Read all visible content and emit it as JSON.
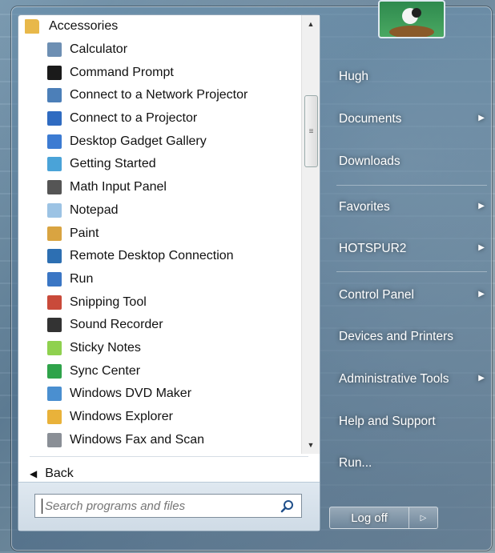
{
  "programs": {
    "folder": {
      "label": "Accessories",
      "icon": "folder-icon",
      "color": "#e8b84a"
    },
    "items": [
      {
        "label": "Calculator",
        "icon": "calculator-icon",
        "color": "#6d8fb3"
      },
      {
        "label": "Command Prompt",
        "icon": "command-prompt-icon",
        "color": "#1a1a1a"
      },
      {
        "label": "Connect to a Network Projector",
        "icon": "network-projector-icon",
        "color": "#4c7fb8"
      },
      {
        "label": "Connect to a Projector",
        "icon": "projector-icon",
        "color": "#2f6bc1"
      },
      {
        "label": "Desktop Gadget Gallery",
        "icon": "gadget-gallery-icon",
        "color": "#3c7bd2"
      },
      {
        "label": "Getting Started",
        "icon": "getting-started-icon",
        "color": "#4aa3d8"
      },
      {
        "label": "Math Input Panel",
        "icon": "math-input-icon",
        "color": "#555555"
      },
      {
        "label": "Notepad",
        "icon": "notepad-icon",
        "color": "#9cc3e4"
      },
      {
        "label": "Paint",
        "icon": "paint-icon",
        "color": "#d9a441"
      },
      {
        "label": "Remote Desktop Connection",
        "icon": "remote-desktop-icon",
        "color": "#2d6fb2"
      },
      {
        "label": "Run",
        "icon": "run-icon",
        "color": "#3a76c4"
      },
      {
        "label": "Snipping Tool",
        "icon": "snipping-tool-icon",
        "color": "#c94a3a"
      },
      {
        "label": "Sound Recorder",
        "icon": "microphone-icon",
        "color": "#333333"
      },
      {
        "label": "Sticky Notes",
        "icon": "sticky-notes-icon",
        "color": "#8fd14f"
      },
      {
        "label": "Sync Center",
        "icon": "sync-center-icon",
        "color": "#2fa34a"
      },
      {
        "label": "Windows DVD Maker",
        "icon": "dvd-maker-icon",
        "color": "#4a8fd0"
      },
      {
        "label": "Windows Explorer",
        "icon": "explorer-folder-icon",
        "color": "#e9b23a"
      },
      {
        "label": "Windows Fax and Scan",
        "icon": "fax-scan-icon",
        "color": "#8a8f96"
      }
    ]
  },
  "back_label": "Back",
  "search": {
    "placeholder": "Search programs and files"
  },
  "user_name": "Hugh",
  "right_items": [
    {
      "label": "Documents",
      "arrow": true
    },
    {
      "label": "Downloads",
      "arrow": false
    },
    {
      "label": "Favorites",
      "arrow": true
    },
    {
      "label": "HOTSPUR2",
      "arrow": true
    },
    {
      "label": "Control Panel",
      "arrow": true
    },
    {
      "label": "Devices and Printers",
      "arrow": false
    },
    {
      "label": "Administrative Tools",
      "arrow": true
    },
    {
      "label": "Help and Support",
      "arrow": false
    },
    {
      "label": "Run...",
      "arrow": false
    }
  ],
  "logoff_label": "Log off"
}
